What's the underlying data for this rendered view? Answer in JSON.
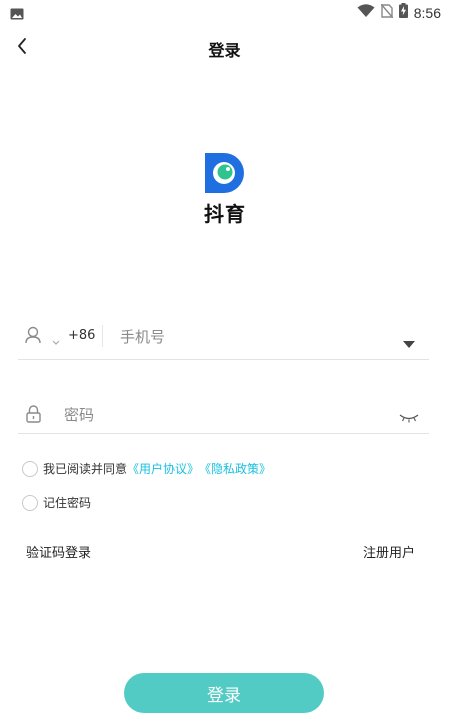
{
  "status_bar": {
    "time": "8:56",
    "icons": [
      "image-icon",
      "wifi-icon",
      "no-sim-icon",
      "battery-charging-icon"
    ]
  },
  "app_bar": {
    "title": "登录",
    "back_icon": "chevron-left-icon"
  },
  "logo": {
    "text": "抖育",
    "mark_letter": "D",
    "colors": {
      "mark": "#1f6fe0",
      "dot": "#2ec38f"
    }
  },
  "phone": {
    "country_code": "+86",
    "placeholder": "手机号",
    "value": ""
  },
  "password": {
    "placeholder": "密码",
    "value": ""
  },
  "agreement": {
    "prefix": "我已阅读并同意",
    "user_agreement": "《用户协议》",
    "privacy_policy": "《隐私政策》",
    "checked": false
  },
  "remember": {
    "label": "记住密码",
    "checked": false
  },
  "links": {
    "sms_login": "验证码登录",
    "register": "注册用户"
  },
  "login_button": {
    "label": "登录"
  },
  "colors": {
    "accent": "#53cbc5",
    "link": "#19c0e0"
  }
}
